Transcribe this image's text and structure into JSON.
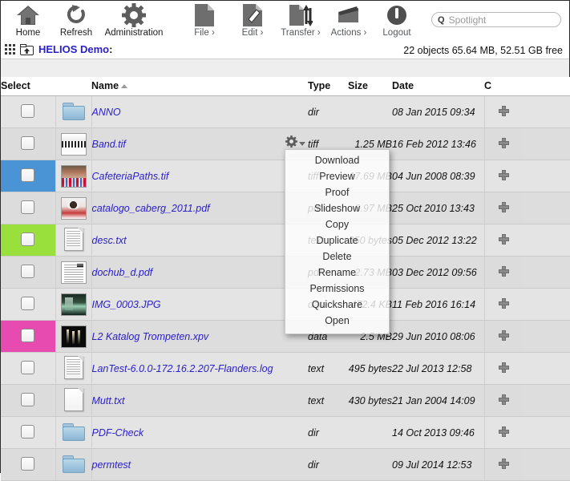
{
  "toolbar": {
    "buttons": [
      {
        "label": "Home",
        "icon": "home-icon",
        "dim": false
      },
      {
        "label": "Refresh",
        "icon": "refresh-icon",
        "dim": false
      },
      {
        "label": "Administration",
        "icon": "gear-icon",
        "dim": false
      },
      {
        "label": "File ›",
        "icon": "file-icon",
        "dim": true
      },
      {
        "label": "Edit ›",
        "icon": "edit-icon",
        "dim": true
      },
      {
        "label": "Transfer ›",
        "icon": "transfer-icon",
        "dim": true
      },
      {
        "label": "Actions ›",
        "icon": "actions-icon",
        "dim": true
      },
      {
        "label": "Logout",
        "icon": "logout-icon",
        "dim": true
      }
    ]
  },
  "search": {
    "placeholder": "Spotlight",
    "glyph": "Q"
  },
  "pathbar": {
    "grid_icon": "grid-view-icon",
    "up_icon": "up-folder-icon",
    "volume": "HELIOS Demo",
    "colon": ":"
  },
  "status": {
    "text": "22 objects 65.64 MB, 52.51 GB free"
  },
  "table": {
    "columns": {
      "select": "Select",
      "name": "Name",
      "type": "Type",
      "size": "Size",
      "date": "Date",
      "c": "C"
    },
    "sort": {
      "column": "Name",
      "direction": "asc"
    },
    "rows": [
      {
        "name": "ANNO",
        "type": "dir",
        "size": "",
        "date": "08 Jan 2015 09:34",
        "icon": "folder-icon",
        "thumb": "folder",
        "highlight": ""
      },
      {
        "name": "Band.tif",
        "type": "tiff",
        "size": "1.25 MB",
        "date": "16 Feb 2012 13:46",
        "icon": "image-thumb",
        "thumb": "band",
        "highlight": ""
      },
      {
        "name": "CafeteriaPaths.tif",
        "type": "tiff",
        "size": "17.69 MB",
        "date": "04 Jun 2008 08:39",
        "icon": "image-thumb",
        "thumb": "street",
        "highlight": "#4a94d6"
      },
      {
        "name": "catalogo_caberg_2011.pdf",
        "type": "pdf",
        "size": "6.97 MB",
        "date": "25 Oct 2010 13:43",
        "icon": "image-thumb",
        "thumb": "girl",
        "highlight": ""
      },
      {
        "name": "desc.txt",
        "type": "text",
        "size": "650 bytes",
        "date": "05 Dec 2012 13:22",
        "icon": "document-icon",
        "thumb": "doc",
        "highlight": "#9ae03c"
      },
      {
        "name": "dochub_d.pdf",
        "type": "pdf",
        "size": "2.73 MB",
        "date": "03 Dec 2012 09:56",
        "icon": "pdf-thumb",
        "thumb": "pdf",
        "highlight": ""
      },
      {
        "name": "IMG_0003.JPG",
        "type": "data",
        "size": "472.4 KB",
        "date": "11 Feb 2016 16:14",
        "icon": "image-thumb",
        "thumb": "night",
        "highlight": ""
      },
      {
        "name": "L2 Katalog Trompeten.xpv",
        "type": "data",
        "size": "2.5 MB",
        "date": "29 Jun 2010 08:06",
        "icon": "image-thumb",
        "thumb": "dark",
        "highlight": "#e84bb0"
      },
      {
        "name": "LanTest-6.0.0-172.16.2.207-Flanders.log",
        "type": "text",
        "size": "495 bytes",
        "date": "22 Jul 2013 12:58",
        "icon": "document-icon",
        "thumb": "doc",
        "highlight": ""
      },
      {
        "name": "Mutt.txt",
        "type": "text",
        "size": "430 bytes",
        "date": "21 Jan 2004 14:09",
        "icon": "document-icon",
        "thumb": "blank",
        "highlight": ""
      },
      {
        "name": "PDF-Check",
        "type": "dir",
        "size": "",
        "date": "14 Oct 2013 09:46",
        "icon": "folder-icon",
        "thumb": "folder",
        "highlight": ""
      },
      {
        "name": "permtest",
        "type": "dir",
        "size": "",
        "date": "09 Jul 2014 12:53",
        "icon": "folder-icon",
        "thumb": "folder",
        "highlight": ""
      }
    ],
    "c_icon": "add-plus-icon"
  },
  "context_menu": {
    "trigger_icon": "gear-icon",
    "items": [
      "Download",
      "Preview",
      "Proof",
      "Slideshow",
      "Copy",
      "Duplicate",
      "Delete",
      "Rename",
      "Permissions",
      "Quickshare",
      "Open"
    ]
  },
  "colors": {
    "link": "#2b20c8",
    "select_blue": "#4a94d6",
    "select_green": "#9ae03c",
    "select_magenta": "#e84bb0"
  }
}
